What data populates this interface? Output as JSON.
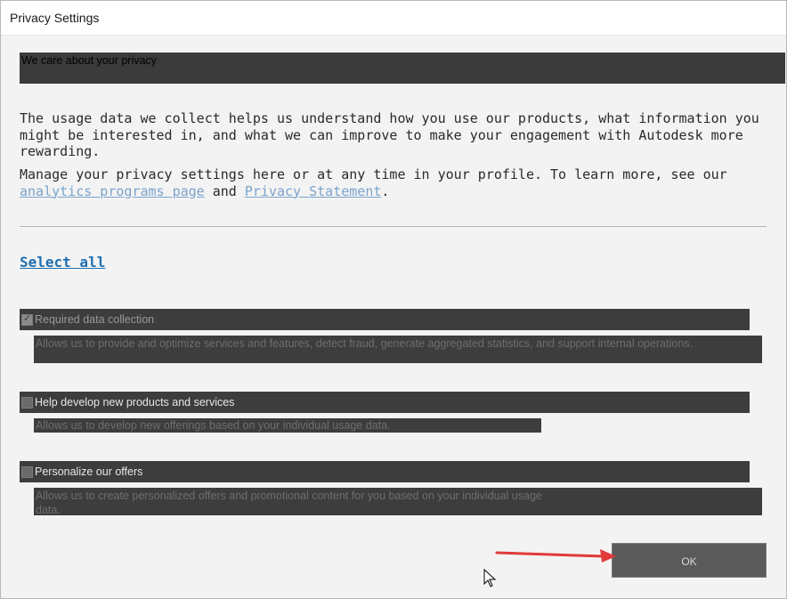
{
  "window": {
    "title": "Privacy Settings"
  },
  "banner": {
    "text": "We care about your privacy"
  },
  "intro": {
    "paragraph1": "The usage data we collect helps us understand how you use our products, what information you might be interested in, and what we can improve to make your engagement with Autodesk more rewarding.",
    "paragraph2_prefix": "Manage your privacy settings here or at any time in your profile. To learn more, see our ",
    "analytics_link": "analytics programs page",
    "and": " and ",
    "privacy_link": "Privacy Statement",
    "period": "."
  },
  "select_all": "Select all",
  "options": [
    {
      "label": "Required data collection",
      "checked": true,
      "disabled": true,
      "description": "Allows us to provide and optimize services and features, detect fraud, generate aggregated statistics, and support internal operations."
    },
    {
      "label": "Help develop new products and services",
      "checked": false,
      "disabled": false,
      "description": "Allows us to develop new offerings based on your individual usage data."
    },
    {
      "label": "Personalize our offers",
      "checked": false,
      "disabled": false,
      "description": "Allows us to create personalized offers and promotional content for you based on your individual usage data."
    }
  ],
  "ok_button": "OK",
  "colors": {
    "annotation_arrow": "#e03a3a",
    "link": "#7aa3cc",
    "select_all": "#1f6fb2"
  }
}
